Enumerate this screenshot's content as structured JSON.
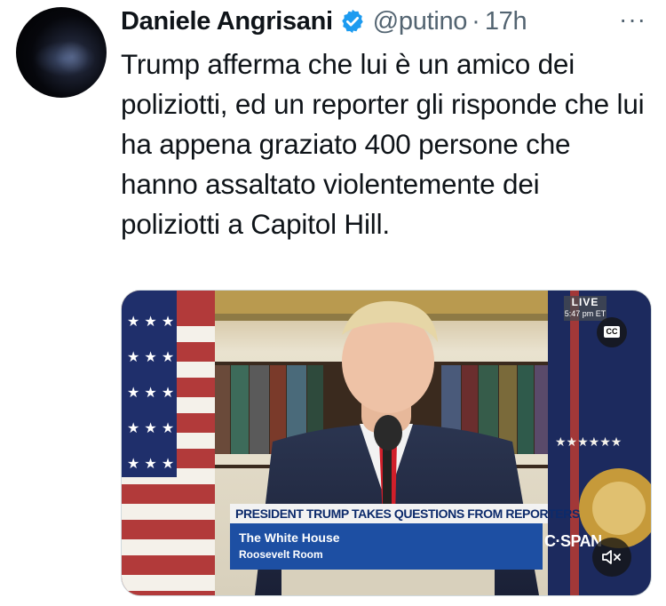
{
  "tweet": {
    "author_name": "Daniele Angrisani",
    "handle": "@putino",
    "separator": "·",
    "time": "17h",
    "more_label": "···",
    "text": "Trump afferma che lui è un amico dei poliziotti, ed un reporter gli risponde che lui ha appena graziato 400 persone che hanno assaltato violentemente dei poliziotti a Capitol Hill."
  },
  "video": {
    "live_label": "LIVE",
    "live_time": "5:47 pm ET",
    "cc_label": "CC",
    "headline": "PRESIDENT TRUMP TAKES QUESTIONS FROM REPORTERS",
    "location_title": "The White House",
    "location_subtitle": "Roosevelt Room",
    "network": "C·SPAN"
  },
  "icons": {
    "verified": "verified-badge-icon",
    "more": "more-horizontal-icon",
    "mute": "speaker-muted-icon",
    "cc": "closed-captions-icon"
  },
  "colors": {
    "verified_blue": "#1d9bf0",
    "secondary_text": "#536471",
    "text": "#0f1419",
    "cspan_blue": "#1d4fa3"
  }
}
